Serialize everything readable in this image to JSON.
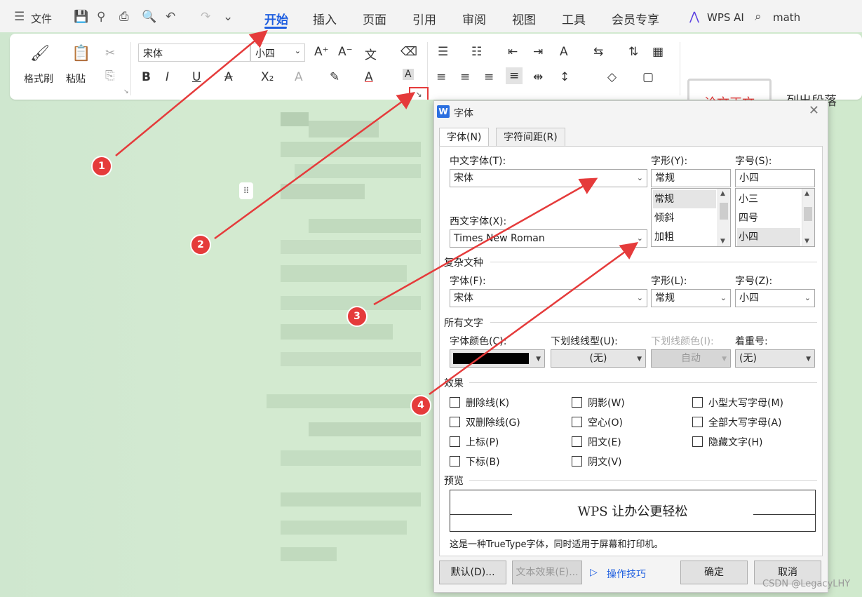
{
  "menubar": {
    "file_label": "文件",
    "tabs": [
      "开始",
      "插入",
      "页面",
      "引用",
      "审阅",
      "视图",
      "工具",
      "会员专享"
    ],
    "wps_ai": "WPS AI",
    "search_text": "math"
  },
  "ribbon": {
    "format_painter": "格式刷",
    "paste": "粘贴",
    "font_name": "宋体",
    "font_size": "小四",
    "style_body": "论文正文",
    "style_list": "列出段落"
  },
  "dialog": {
    "title": "字体",
    "tabs": [
      "字体(N)",
      "字符间距(R)"
    ],
    "labels": {
      "cn_font": "中文字体(T):",
      "style": "字形(Y):",
      "size": "字号(S):",
      "west_font": "西文字体(X):",
      "complex_section": "复杂文种",
      "complex_font": "字体(F):",
      "complex_style": "字形(L):",
      "complex_size": "字号(Z):",
      "all_text_section": "所有文字",
      "font_color": "字体颜色(C):",
      "underline_type": "下划线线型(U):",
      "underline_color": "下划线颜色(I):",
      "emphasis": "着重号:",
      "effects_section": "效果",
      "preview_section": "预览"
    },
    "values": {
      "cn_font": "宋体",
      "style": "常规",
      "size": "小四",
      "west_font": "Times New Roman",
      "complex_font": "宋体",
      "complex_style": "常规",
      "complex_size": "小四",
      "underline_type": "(无)",
      "underline_color": "自动",
      "emphasis": "(无)",
      "font_color_hex": "#000000"
    },
    "style_list": [
      "常规",
      "倾斜",
      "加粗"
    ],
    "size_list": [
      "小三",
      "四号",
      "小四"
    ],
    "effects": [
      "删除线(K)",
      "阴影(W)",
      "小型大写字母(M)",
      "双删除线(G)",
      "空心(O)",
      "全部大写字母(A)",
      "上标(P)",
      "阳文(E)",
      "隐藏文字(H)",
      "下标(B)",
      "阴文(V)"
    ],
    "preview_text": "WPS 让办公更轻松",
    "preview_note": "这是一种TrueType字体，同时适用于屏幕和打印机。",
    "buttons": {
      "default": "默认(D)...",
      "text_effect": "文本效果(E)...",
      "tips": "操作技巧",
      "ok": "确定",
      "cancel": "取消"
    }
  },
  "markers": [
    "1",
    "2",
    "3",
    "4"
  ],
  "watermark": "CSDN @LegacyLHY",
  "colors": {
    "accent": "#1f5fe0",
    "marker": "#e53b3b"
  }
}
